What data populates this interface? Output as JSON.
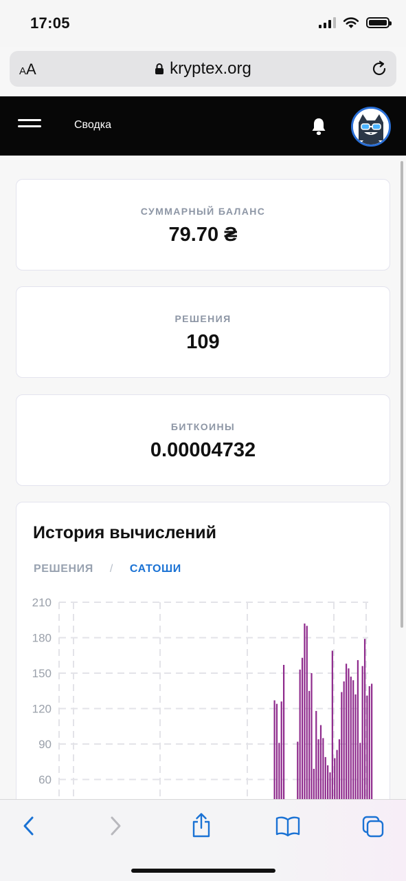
{
  "status": {
    "time": "17:05"
  },
  "browser": {
    "aa_small": "A",
    "aa_big": "A",
    "url": "kryptex.org"
  },
  "header": {
    "title": "Сводка"
  },
  "cards": [
    {
      "label": "СУММАРНЫЙ БАЛАНС",
      "value": "79.70 ₴"
    },
    {
      "label": "РЕШЕНИЯ",
      "value": "109"
    },
    {
      "label": "БИТКОИНЫ",
      "value": "0.00004732"
    }
  ],
  "history": {
    "title": "История вычислений",
    "tabs": {
      "solutions": "РЕШЕНИЯ",
      "separator": "/",
      "satoshi": "САТОШИ"
    }
  },
  "chart_data": {
    "type": "bar",
    "yticks": [
      "210",
      "180",
      "150",
      "120",
      "90",
      "60"
    ],
    "ylim": [
      30,
      210
    ],
    "grid": true,
    "color": "#8e2a8c",
    "values": [
      127,
      124,
      91,
      126,
      157,
      0,
      0,
      0,
      0,
      0,
      92,
      153,
      163,
      192,
      190,
      135,
      150,
      69,
      118,
      94,
      106,
      95,
      79,
      72,
      66,
      169,
      78,
      85,
      94,
      134,
      143,
      158,
      154,
      147,
      144,
      132,
      161,
      91,
      156,
      179,
      131,
      139,
      141
    ]
  },
  "icons": [
    "menu-icon",
    "bell-icon",
    "avatar-cat",
    "lock-icon",
    "reload-icon",
    "back-icon",
    "forward-icon",
    "share-icon",
    "bookmarks-icon",
    "tabs-icon"
  ]
}
